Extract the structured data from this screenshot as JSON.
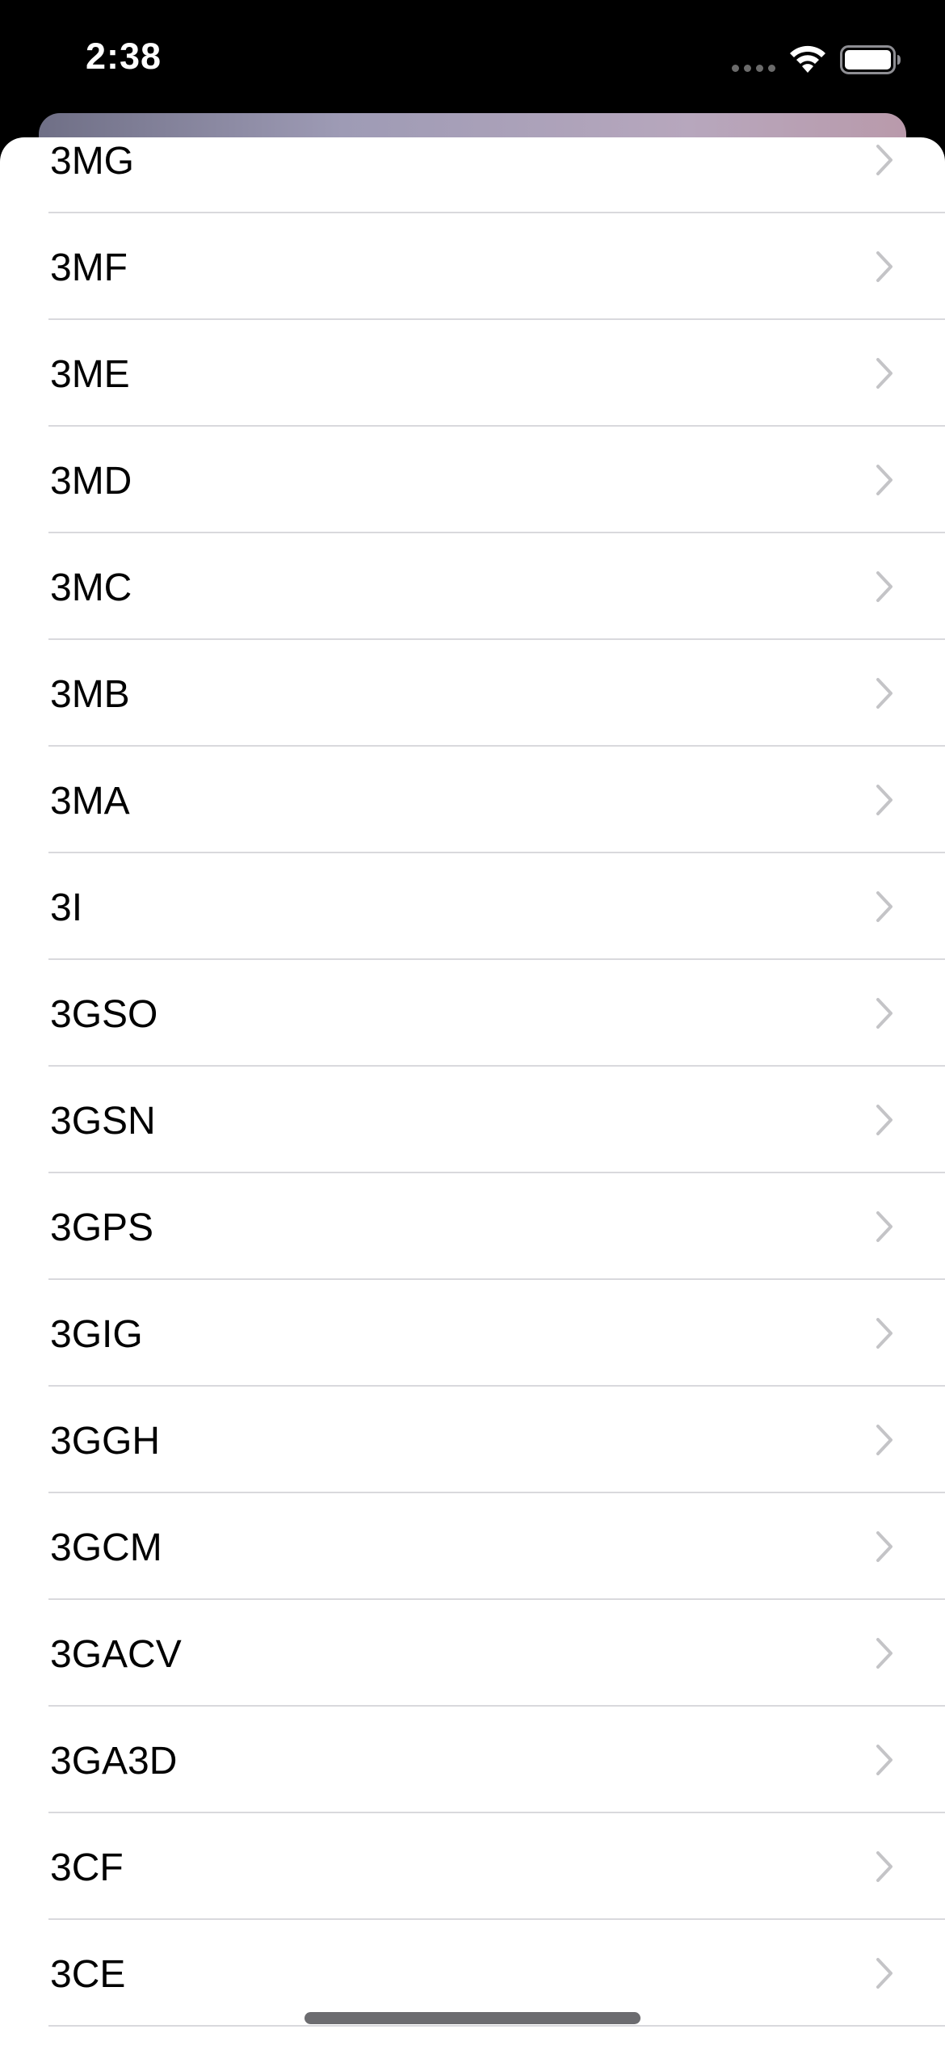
{
  "status_bar": {
    "time": "2:38"
  },
  "list": {
    "items": [
      {
        "label": "3MG"
      },
      {
        "label": "3MF"
      },
      {
        "label": "3ME"
      },
      {
        "label": "3MD"
      },
      {
        "label": "3MC"
      },
      {
        "label": "3MB"
      },
      {
        "label": "3MA"
      },
      {
        "label": "3I"
      },
      {
        "label": "3GSO"
      },
      {
        "label": "3GSN"
      },
      {
        "label": "3GPS"
      },
      {
        "label": "3GIG"
      },
      {
        "label": "3GGH"
      },
      {
        "label": "3GCM"
      },
      {
        "label": "3GACV"
      },
      {
        "label": "3GA3D"
      },
      {
        "label": "3CF"
      },
      {
        "label": "3CE"
      }
    ]
  },
  "icons": {
    "row_disclosure": "chevron-right-icon",
    "wifi": "wifi-icon",
    "battery": "battery-icon",
    "signal": "cellular-signal-icon"
  },
  "colors": {
    "status_bar_background": "#000000",
    "sheet_background": "#ffffff",
    "separator": "#d9d9dd",
    "chevron": "#c4c4c7"
  }
}
